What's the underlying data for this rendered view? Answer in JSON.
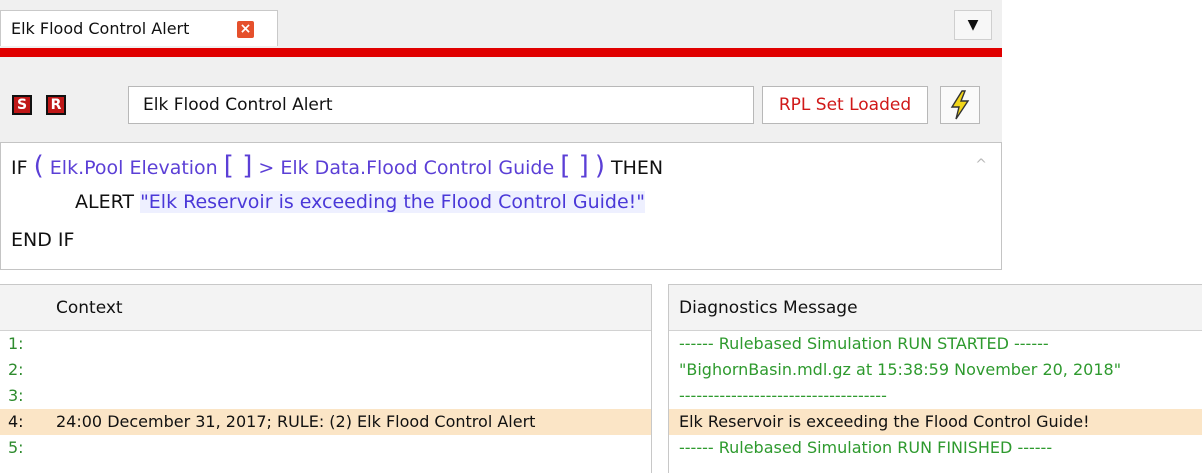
{
  "editor": {
    "tab_title": "Elk Flood Control Alert",
    "dropdown_glyph": "▼",
    "s_button": "S",
    "r_button": "R",
    "set_name": "Elk Flood Control Alert",
    "status": "RPL Set Loaded",
    "code": {
      "if_kw": "IF",
      "ref1": "Elk.Pool Elevation",
      "op": ">",
      "ref2": "Elk Data.Flood Control Guide",
      "then_kw": "THEN",
      "alert_kw": "ALERT",
      "alert_msg": "\"Elk Reservoir is exceeding the Flood Control Guide!\"",
      "endif_kw": "END IF"
    }
  },
  "context_table": {
    "header": "Context",
    "rows": [
      {
        "num": "1:",
        "text": ""
      },
      {
        "num": "2:",
        "text": ""
      },
      {
        "num": "3:",
        "text": ""
      },
      {
        "num": "4:",
        "text": "24:00 December 31, 2017; RULE: (2) Elk Flood Control Alert"
      },
      {
        "num": "5:",
        "text": ""
      }
    ]
  },
  "diagnostics_table": {
    "header": "Diagnostics Message",
    "rows": [
      "------ Rulebased Simulation RUN STARTED ------",
      "\"BighornBasin.mdl.gz at 15:38:59 November 20, 2018\"",
      "------------------------------------",
      "Elk Reservoir is exceeding the Flood Control Guide!",
      "------ Rulebased Simulation RUN FINISHED ------"
    ]
  },
  "colors": {
    "accent_red": "#e00000",
    "selected_row": "#fbe5c6",
    "code_ref": "#5b3fd6",
    "diag_green": "#2e9a2e"
  }
}
